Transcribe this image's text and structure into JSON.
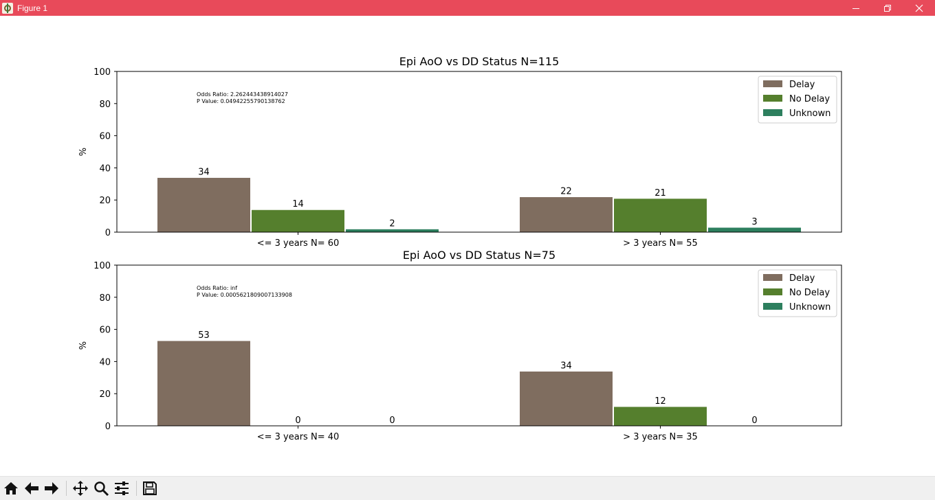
{
  "window": {
    "title": "Figure 1",
    "icon": "matplotlib-figure-icon"
  },
  "window_controls": [
    "minimize-icon",
    "restore-icon",
    "close-icon"
  ],
  "colors": {
    "Delay": "#7f6d5f",
    "No Delay": "#557f2d",
    "Unknown": "#2d7f5e",
    "titlebar": "#e84a5a"
  },
  "toolbar": [
    "home-icon",
    "back-arrow-icon",
    "forward-arrow-icon",
    "pan-icon",
    "zoom-icon",
    "configure-subplots-icon",
    "save-icon"
  ],
  "chart_data": [
    {
      "type": "bar",
      "title": "Epi AoO vs DD Status N=115",
      "ylabel": "%",
      "xlabel": "",
      "ylim": [
        0,
        100
      ],
      "yticks": [
        0,
        20,
        40,
        60,
        80,
        100
      ],
      "categories": [
        "<= 3 years N= 60",
        "> 3 years N= 55"
      ],
      "series": [
        {
          "name": "Delay",
          "values": [
            34,
            22
          ]
        },
        {
          "name": "No Delay",
          "values": [
            14,
            21
          ]
        },
        {
          "name": "Unknown",
          "values": [
            2,
            3
          ]
        }
      ],
      "data_labels": [
        [
          "34",
          "22"
        ],
        [
          "14",
          "21"
        ],
        [
          "2",
          "3"
        ]
      ],
      "annotation": [
        "Odds Ratio: 2.262443438914027",
        "P Value: 0.04942255790138762"
      ],
      "legend": {
        "position": "top-right",
        "entries": [
          "Delay",
          "No Delay",
          "Unknown"
        ]
      },
      "grid": false
    },
    {
      "type": "bar",
      "title": "Epi AoO vs DD Status N=75",
      "ylabel": "%",
      "xlabel": "",
      "ylim": [
        0,
        100
      ],
      "yticks": [
        0,
        20,
        40,
        60,
        80,
        100
      ],
      "categories": [
        "<= 3 years N= 40",
        "> 3 years N= 35"
      ],
      "series": [
        {
          "name": "Delay",
          "values": [
            53,
            34
          ]
        },
        {
          "name": "No Delay",
          "values": [
            0,
            12
          ]
        },
        {
          "name": "Unknown",
          "values": [
            0,
            0
          ]
        }
      ],
      "data_labels": [
        [
          "53",
          "34"
        ],
        [
          "0",
          "12"
        ],
        [
          "0",
          "0"
        ]
      ],
      "annotation": [
        "Odds Ratio: inf",
        "P Value: 0.0005621809007133908"
      ],
      "legend": {
        "position": "top-right",
        "entries": [
          "Delay",
          "No Delay",
          "Unknown"
        ]
      },
      "grid": false
    }
  ]
}
